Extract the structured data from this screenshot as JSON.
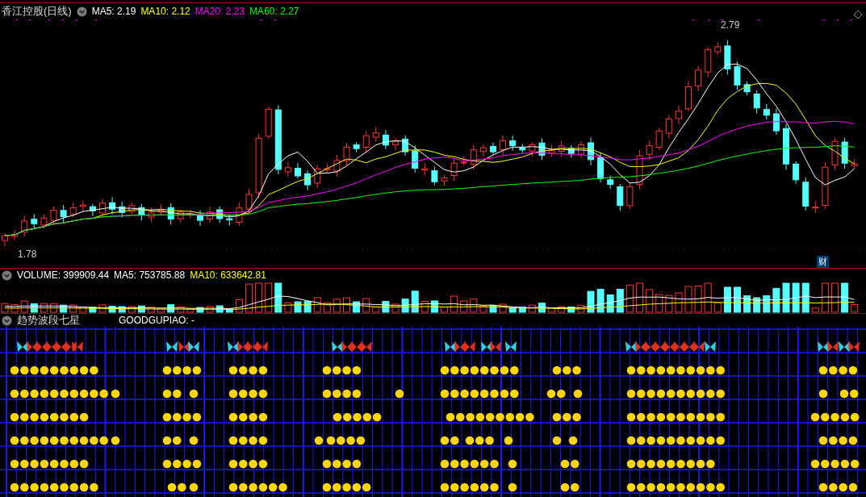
{
  "chart": {
    "title": "香江控股(日线)",
    "ma": [
      {
        "label": "MA5: 2.19",
        "color": "#ffffff"
      },
      {
        "label": "MA10: 2.12",
        "color": "#ffff00"
      },
      {
        "label": "MA20: 2.23",
        "color": "#ff00ff"
      },
      {
        "label": "MA60: 2.27",
        "color": "#00ff00"
      }
    ],
    "high_mark": "2.79",
    "low_mark": "1.78",
    "badge": "财"
  },
  "volume": {
    "items": [
      {
        "label": "VOLUME: 399909.44",
        "color": "#ffffff"
      },
      {
        "label": "MA5: 753785.88",
        "color": "#ffffff"
      },
      {
        "label": "MA10: 633642.81",
        "color": "#ffff00"
      }
    ]
  },
  "indicator": {
    "title": "趋势波段七星",
    "value": "GOODGUPIAO: -"
  }
}
